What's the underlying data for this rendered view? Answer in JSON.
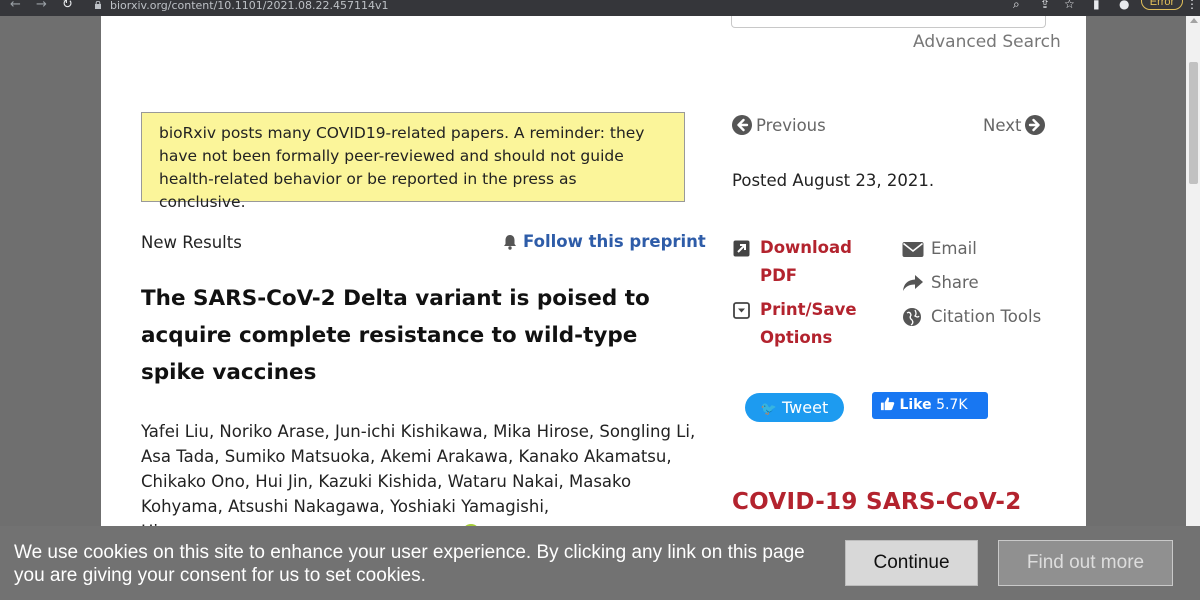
{
  "browser": {
    "url": "biorxiv.org/content/10.1101/2021.08.22.457114v1",
    "error_label": "Error",
    "back_glyph": "←",
    "forward_glyph": "→",
    "reload_glyph": "↻",
    "icons": [
      "lock-icon",
      "zoom-icon",
      "share-icon",
      "star-icon",
      "sidebar-icon",
      "profile-icon",
      "menu-icon"
    ]
  },
  "header": {
    "advanced_search": "Advanced Search"
  },
  "notice": {
    "text": "bioRxiv posts many COVID19-related papers. A reminder: they have not been formally peer-reviewed and should not guide health-related behavior or be reported in the press as conclusive."
  },
  "article": {
    "section_label": "New Results",
    "follow_label": "Follow this preprint",
    "title": "The SARS-CoV-2 Delta variant is poised to acquire complete resistance to wild-type spike vaccines",
    "authors_visible": "Yafei Liu, Noriko Arase, Jun-ichi Kishikawa, Mika Hirose, Songling Li, Asa Tada, Sumiko Matsuoka, Akemi Arakawa, Kanako Akamatsu, Chikako Ono, Hui Jin, Kazuki Kishida, Wataru Nakai, Masako Kohyama, Atsushi Nakagawa, Yoshiaki Yamagishi,"
  },
  "sidebar": {
    "previous": "Previous",
    "next": "Next",
    "posted": "Posted August 23, 2021.",
    "actions": {
      "download_pdf": [
        "Download",
        "PDF"
      ],
      "print_save": [
        "Print/Save",
        "Options"
      ],
      "email": "Email",
      "share": "Share",
      "citation_tools": "Citation Tools"
    },
    "social": {
      "tweet": "Tweet",
      "like": "Like",
      "like_count": "5.7K"
    },
    "covid_heading": "COVID-19 SARS-CoV-2"
  },
  "cookie_banner": {
    "text": "We use cookies on this site to enhance your user experience. By clicking any link on this page you are giving your consent for us to set cookies.",
    "continue_label": "Continue",
    "find_out_more_label": "Find out more"
  },
  "colors": {
    "accent_red": "#b3232e",
    "link_blue": "#2e5ca8",
    "notice_yellow": "#fbf59a",
    "tweet_blue": "#1d9bf0",
    "like_blue": "#1877f2"
  }
}
